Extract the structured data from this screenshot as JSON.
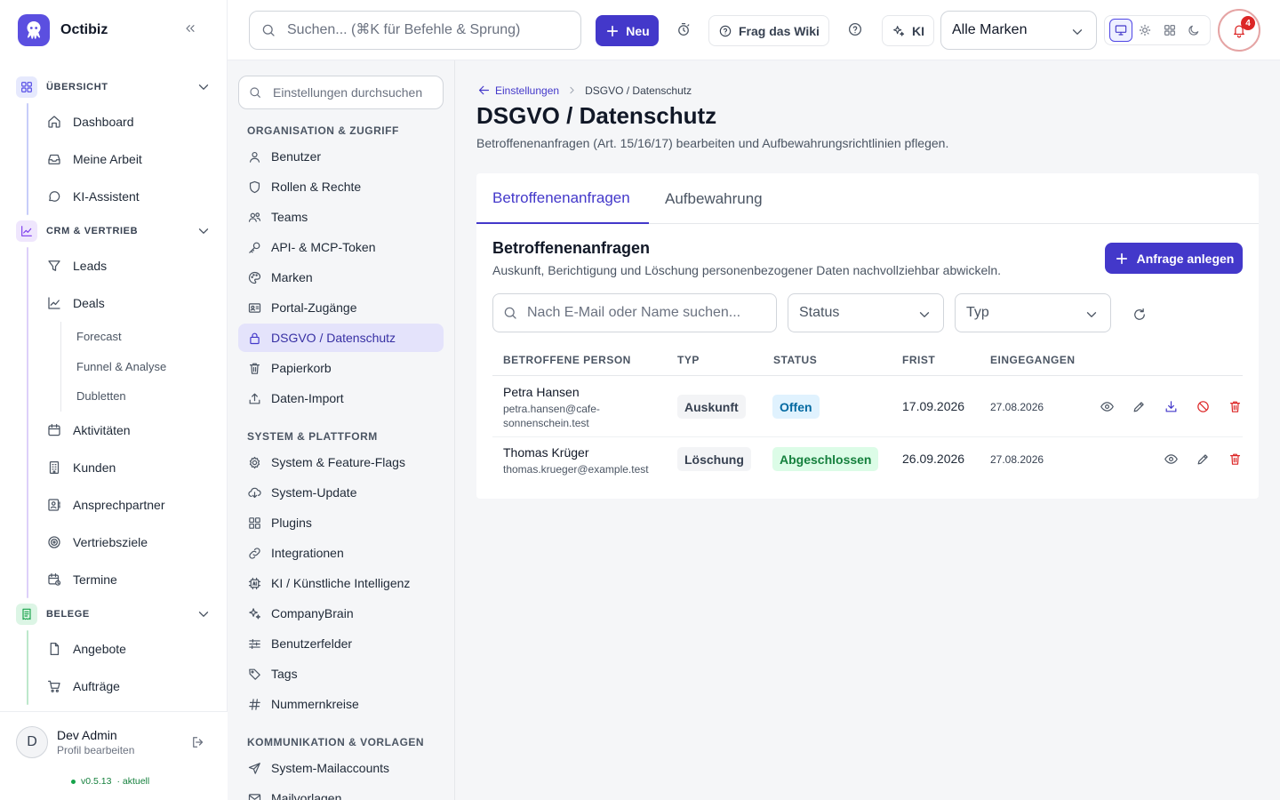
{
  "app": {
    "name": "Octibiz",
    "colors": {
      "accent": "#4338ca",
      "danger": "#dc2626",
      "success": "#15803d"
    }
  },
  "sidebar": {
    "sections": [
      {
        "label": "ÜBERSICHT",
        "icon": "grid-icon",
        "items": [
          "Dashboard",
          "Meine Arbeit",
          "KI-Assistent"
        ]
      },
      {
        "label": "CRM & VERTRIEB",
        "icon": "chart-line-icon",
        "items": [
          "Leads",
          "Deals",
          "Aktivitäten",
          "Kunden",
          "Ansprechpartner",
          "Vertriebsziele",
          "Termine"
        ],
        "deals_sub": [
          "Forecast",
          "Funnel & Analyse",
          "Dubletten"
        ]
      },
      {
        "label": "BELEGE",
        "icon": "receipt-icon",
        "items": [
          "Angebote",
          "Aufträge"
        ]
      }
    ]
  },
  "user": {
    "initial": "D",
    "name": "Dev Admin",
    "profile_link": "Profil bearbeiten",
    "version": "v0.5.13",
    "version_status": "· aktuell"
  },
  "topbar": {
    "search_placeholder": "Suchen... (⌘K für Befehle & Sprung)",
    "new_label": "Neu",
    "wiki_label": "Frag das Wiki",
    "ai_label": "KI",
    "brand_select": "Alle Marken",
    "notification_count": "4"
  },
  "settings_nav": {
    "search_placeholder": "Einstellungen durchsuchen",
    "groups": [
      {
        "label": "ORGANISATION & ZUGRIFF",
        "items": [
          "Benutzer",
          "Rollen & Rechte",
          "Teams",
          "API- & MCP-Token",
          "Marken",
          "Portal-Zugänge",
          "DSGVO / Datenschutz",
          "Papierkorb",
          "Daten-Import"
        ]
      },
      {
        "label": "SYSTEM & PLATTFORM",
        "items": [
          "System & Feature-Flags",
          "System-Update",
          "Plugins",
          "Integrationen",
          "KI / Künstliche Intelligenz",
          "CompanyBrain",
          "Benutzerfelder",
          "Tags",
          "Nummernkreise"
        ]
      },
      {
        "label": "KOMMUNIKATION & VORLAGEN",
        "items": [
          "System-Mailaccounts",
          "Mailvorlagen"
        ]
      }
    ],
    "active_item": "DSGVO / Datenschutz"
  },
  "main": {
    "breadcrumb_back": "Einstellungen",
    "breadcrumb_current": "DSGVO / Datenschutz",
    "title": "DSGVO / Datenschutz",
    "subtitle": "Betroffenenanfragen (Art. 15/16/17) bearbeiten und Aufbewahrungsrichtlinien pflegen.",
    "tabs": [
      "Betroffenenanfragen",
      "Aufbewahrung"
    ],
    "panel_title": "Betroffenenanfragen",
    "panel_subtitle": "Auskunft, Berichtigung und Löschung personenbezogener Daten nachvollziehbar abwickeln.",
    "add_button": "Anfrage anlegen",
    "filter_search_placeholder": "Nach E-Mail oder Name suchen...",
    "filter_status": "Status",
    "filter_type": "Typ",
    "columns": [
      "BETROFFENE PERSON",
      "TYP",
      "STATUS",
      "FRIST",
      "EINGEGANGEN"
    ],
    "rows": [
      {
        "name": "Petra Hansen",
        "email_line1": "petra.hansen@cafe-",
        "email_line2": "sonnenschein.test",
        "type": "Auskunft",
        "status": "Offen",
        "deadline": "17.09.2026",
        "received": "27.08.2026"
      },
      {
        "name": "Thomas Krüger",
        "email_line1": "thomas.krueger@example.test",
        "type": "Löschung",
        "status": "Abgeschlossen",
        "deadline": "26.09.2026",
        "received": "27.08.2026"
      }
    ]
  }
}
